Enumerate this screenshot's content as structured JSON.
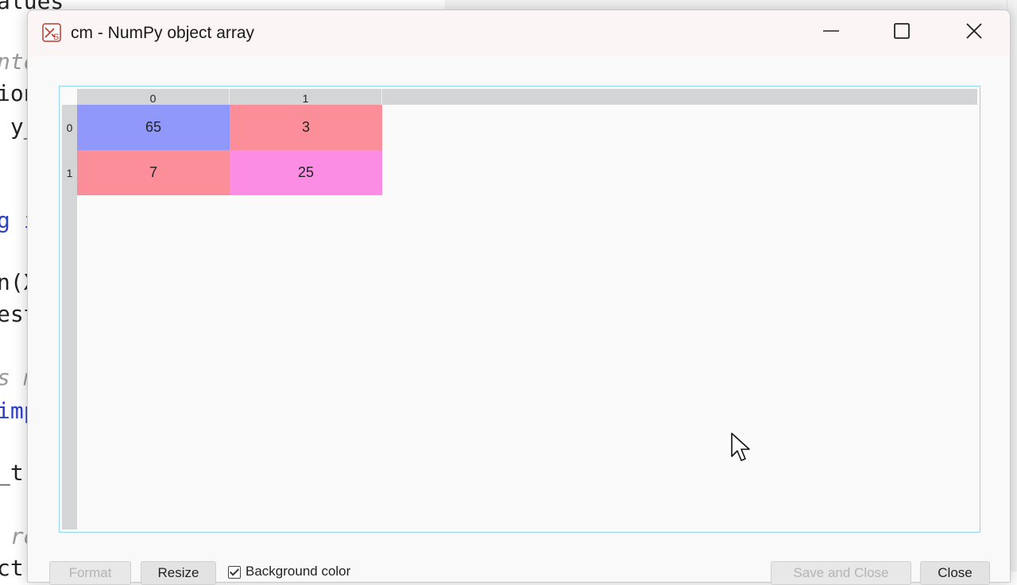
{
  "editor": {
    "lines": [
      {
        "text": "alues",
        "style": "normal"
      },
      {
        "text": "nto",
        "style": "comment"
      },
      {
        "text": "ion",
        "style": "normal"
      },
      {
        "text": " y_",
        "style": "normal"
      },
      {
        "text": "g i",
        "style": "keyword"
      },
      {
        "text": "n(X",
        "style": "normal"
      },
      {
        "text": "est",
        "style": "normal"
      },
      {
        "text": "s m",
        "style": "comment"
      },
      {
        "text": "imp",
        "style": "keyword"
      },
      {
        "text": "_tr",
        "style": "normal"
      },
      {
        "text": " re",
        "style": "comment"
      },
      {
        "text": "ct(",
        "style": "normal"
      }
    ]
  },
  "dialog": {
    "title": "cm - NumPy object array",
    "icons": {
      "app": "spyder-app-icon",
      "minimize": "minimize-icon",
      "maximize": "maximize-icon",
      "close": "close-icon"
    }
  },
  "array": {
    "column_headers": [
      "0",
      "1"
    ],
    "row_headers": [
      "0",
      "1"
    ],
    "rows": [
      [
        {
          "value": "65",
          "color": "#9099fb"
        },
        {
          "value": "3",
          "color": "#fb8e98"
        }
      ],
      [
        {
          "value": "7",
          "color": "#fb8e98"
        },
        {
          "value": "25",
          "color": "#fb8ee4"
        }
      ]
    ]
  },
  "toolbar": {
    "format_label": "Format",
    "resize_label": "Resize",
    "background_color_label": "Background color",
    "background_color_checked": true,
    "save_and_close_label": "Save and Close",
    "close_label": "Close"
  }
}
